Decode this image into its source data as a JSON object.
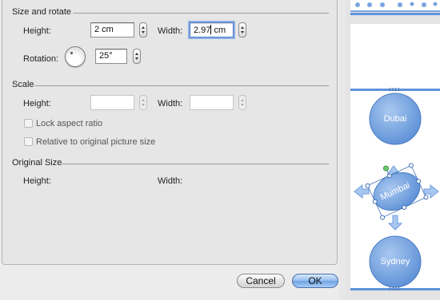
{
  "size_rotate": {
    "title": "Size and rotate",
    "height_label": "Height:",
    "height_value": "2 cm",
    "width_label": "Width:",
    "width_value_before_caret": "2.97",
    "width_value_after_caret": " cm",
    "rotation_label": "Rotation:",
    "rotation_value": "25°"
  },
  "scale": {
    "title": "Scale",
    "height_label": "Height:",
    "height_value": "",
    "width_label": "Width:",
    "width_value": "",
    "lock_aspect_label": "Lock aspect ratio",
    "lock_aspect_checked": false,
    "relative_label": "Relative to original picture size",
    "relative_checked": false
  },
  "original_size": {
    "title": "Original Size",
    "height_label": "Height:",
    "width_label": "Width:"
  },
  "buttons": {
    "cancel": "Cancel",
    "ok": "OK"
  },
  "slides": {
    "shapes": [
      "Dubai",
      "Mumbai",
      "Sydney"
    ],
    "circle_color": "#6f9fdd",
    "selection_color": "#3f6fb5"
  }
}
